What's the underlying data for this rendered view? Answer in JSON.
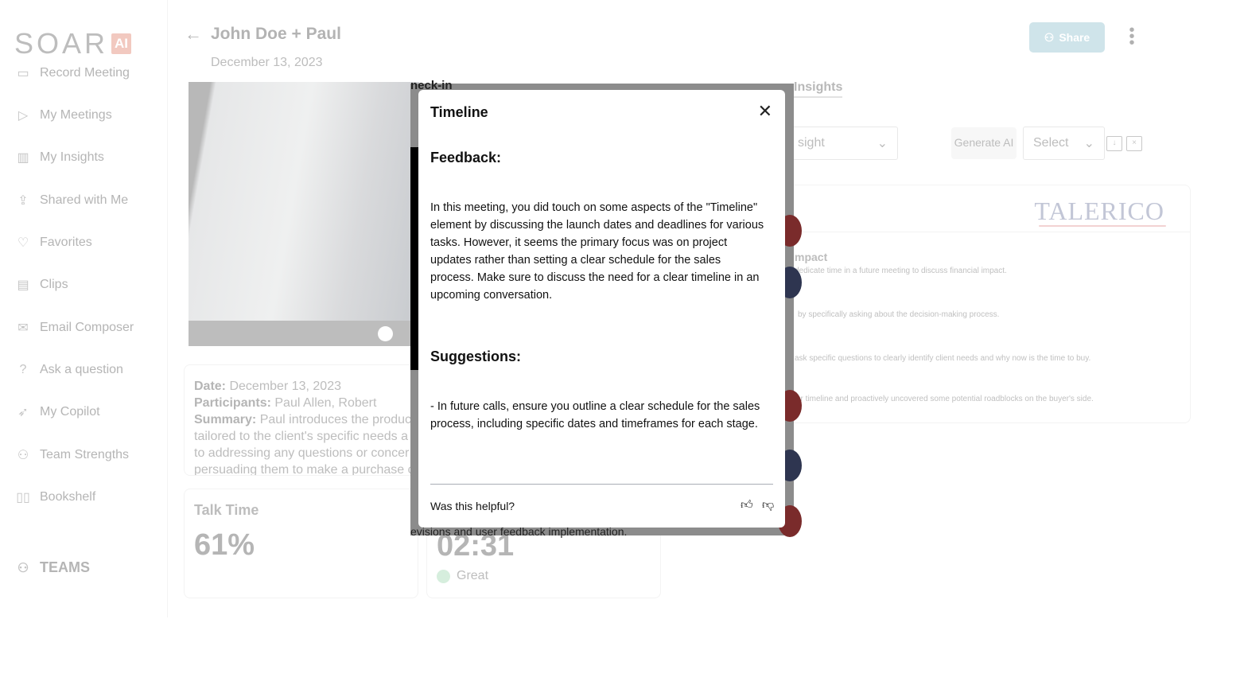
{
  "brand": {
    "name": "SOAR",
    "badge": "AI"
  },
  "sidebar": {
    "items": [
      {
        "label": "Record Meeting",
        "icon": "video-camera-icon",
        "glyph": "▭"
      },
      {
        "label": "My Meetings",
        "icon": "play-circle-icon",
        "glyph": "▷"
      },
      {
        "label": "My Insights",
        "icon": "bar-chart-icon",
        "glyph": "▥"
      },
      {
        "label": "Shared with Me",
        "icon": "share-icon",
        "glyph": "⇪"
      },
      {
        "label": "Favorites",
        "icon": "heart-icon",
        "glyph": "♡"
      },
      {
        "label": "Clips",
        "icon": "clips-icon",
        "glyph": "▤"
      },
      {
        "label": "Email Composer",
        "icon": "mail-icon",
        "glyph": "✉"
      },
      {
        "label": "Ask a question",
        "icon": "question-circle-icon",
        "glyph": "?"
      },
      {
        "label": "My Copilot",
        "icon": "rocket-icon",
        "glyph": "➶"
      },
      {
        "label": "Team Strengths",
        "icon": "users-icon",
        "glyph": "⚇"
      },
      {
        "label": "Bookshelf",
        "icon": "book-icon",
        "glyph": "▯▯"
      }
    ],
    "teams": "TEAMS"
  },
  "header": {
    "title": "John Doe + Paul",
    "date": "December 13, 2023",
    "share": "Share"
  },
  "summary": {
    "date_label": "Date:",
    "date": "December 13, 2023",
    "participants_label": "Participants:",
    "participants": "Paul Allen, Robert",
    "summary_label": "Summary:",
    "lines": [
      "Paul introduces the produc",
      "tailored to the client's specific needs a",
      "to addressing any questions or concer",
      "persuading them to make a purchase c"
    ]
  },
  "talk_time": {
    "label": "Talk Time",
    "value": "61%"
  },
  "pace": {
    "value": "02:31",
    "status": "Great",
    "status_color": "#d6eedd"
  },
  "tabs": {
    "insights": "Insights"
  },
  "controls": {
    "insight_select": "sight",
    "generate": "Generate AI",
    "select": "Select"
  },
  "insights_panel": {
    "logo": "TALERICO",
    "heading": "mpact",
    "rows": [
      "dedicate time in a future meeting to discuss financial impact.",
      "by specifically asking about the decision-making process.",
      "ask  specific questions to clearly identify client needs and why now is the time to buy.",
      "ar timeline and proactively uncovered some potential roadblocks on the buyer's side."
    ]
  },
  "behind_text": {
    "top": "neck-in",
    "bottom": "evisions and user feedback implementation."
  },
  "modal": {
    "title": "Timeline",
    "feedback_heading": "Feedback:",
    "feedback_text": "In this meeting, you did touch on some aspects of the \"Timeline\" element by discussing the launch dates and deadlines for various tasks. However, it seems the primary focus was on project updates rather than setting a clear schedule for the sales process. Make sure to discuss the need for a clear timeline in an upcoming conversation.",
    "suggestions_heading": "Suggestions:",
    "suggestions_text": "- In future calls, ensure you outline a clear schedule for the sales process, including specific dates and timeframes for each stage.",
    "helpful": "Was this helpful?"
  }
}
